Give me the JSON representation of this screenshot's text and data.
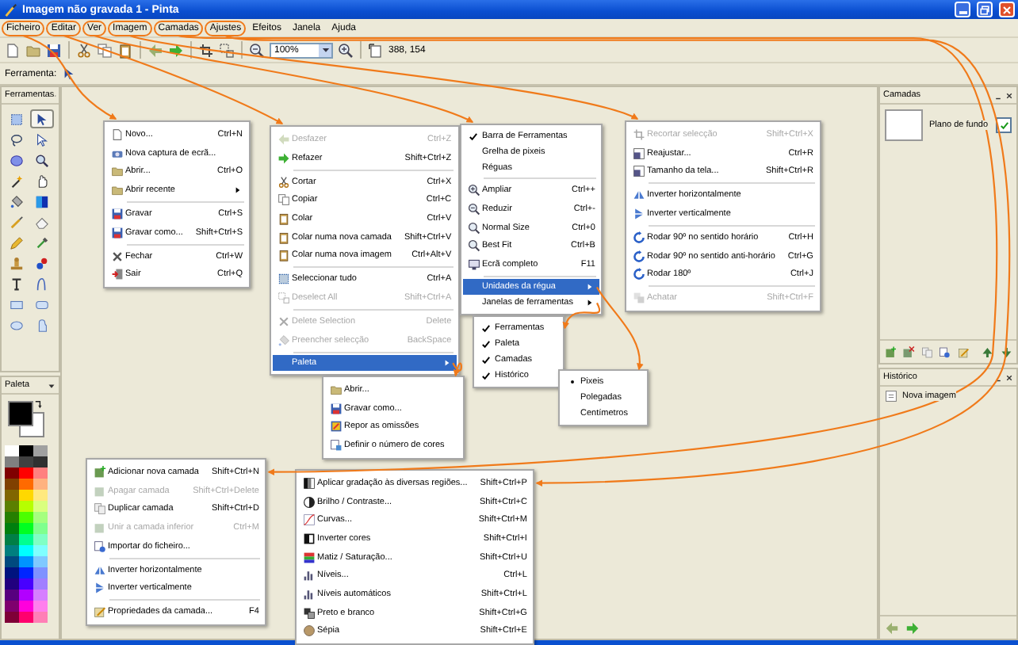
{
  "window": {
    "title": "Imagem não gravada 1 - Pinta"
  },
  "menubar": [
    {
      "label": "Ficheiro",
      "circled": true
    },
    {
      "label": "Editar",
      "circled": true
    },
    {
      "label": "Ver",
      "circled": true
    },
    {
      "label": "Imagem",
      "circled": true
    },
    {
      "label": "Camadas",
      "circled": true
    },
    {
      "label": "Ajustes",
      "circled": true
    },
    {
      "label": "Efeitos",
      "circled": false
    },
    {
      "label": "Janela",
      "circled": false
    },
    {
      "label": "Ajuda",
      "circled": false
    }
  ],
  "toolbar": {
    "zoom": "100%",
    "cursor_position": "388, 154"
  },
  "tool_options": {
    "label": "Ferramenta:"
  },
  "tools_panel": {
    "title": "Ferramentas",
    "tools": [
      {
        "kind": "rectangle-select",
        "selected": false
      },
      {
        "kind": "move-selected",
        "selected": true
      },
      {
        "kind": "lasso",
        "selected": false
      },
      {
        "kind": "move-selection",
        "selected": false
      },
      {
        "kind": "ellipse-select",
        "selected": false
      },
      {
        "kind": "zoom",
        "selected": false
      },
      {
        "kind": "magic-wand",
        "selected": false
      },
      {
        "kind": "pan",
        "selected": false
      },
      {
        "kind": "paint-bucket",
        "selected": false
      },
      {
        "kind": "gradient",
        "selected": false
      },
      {
        "kind": "paintbrush",
        "selected": false
      },
      {
        "kind": "eraser",
        "selected": false
      },
      {
        "kind": "pencil",
        "selected": false
      },
      {
        "kind": "color-picker",
        "selected": false
      },
      {
        "kind": "clone-stamp",
        "selected": false
      },
      {
        "kind": "recolor",
        "selected": false
      },
      {
        "kind": "text",
        "selected": false
      },
      {
        "kind": "line",
        "selected": false
      },
      {
        "kind": "rectangle",
        "selected": false
      },
      {
        "kind": "rounded-rectangle",
        "selected": false
      },
      {
        "kind": "ellipse",
        "selected": false
      },
      {
        "kind": "freeform",
        "selected": false
      }
    ]
  },
  "palette_panel": {
    "title": "Paleta",
    "current_colors": [
      {
        "color": "#000000"
      },
      {
        "color": "#ffffff"
      }
    ],
    "colors": [
      {
        "color": "#ffffff"
      },
      {
        "color": "#000000"
      },
      {
        "color": "#a0a0a0"
      },
      {
        "color": "#808080"
      },
      {
        "color": "#404040"
      },
      {
        "color": "#303030"
      },
      {
        "color": "#800000"
      },
      {
        "color": "#ff0000"
      },
      {
        "color": "#ff8080"
      },
      {
        "color": "#804000"
      },
      {
        "color": "#ff6a00"
      },
      {
        "color": "#ffb280"
      },
      {
        "color": "#806600"
      },
      {
        "color": "#ffd800"
      },
      {
        "color": "#ffe97f"
      },
      {
        "color": "#5b7f00"
      },
      {
        "color": "#b6ff00"
      },
      {
        "color": "#daff7f"
      },
      {
        "color": "#267f00"
      },
      {
        "color": "#4cff00"
      },
      {
        "color": "#a5ff7f"
      },
      {
        "color": "#007f0e"
      },
      {
        "color": "#00ff21"
      },
      {
        "color": "#7fff8e"
      },
      {
        "color": "#007f46"
      },
      {
        "color": "#00ff90"
      },
      {
        "color": "#7fffc5"
      },
      {
        "color": "#007f7f"
      },
      {
        "color": "#00ffff"
      },
      {
        "color": "#7fffff"
      },
      {
        "color": "#004a7f"
      },
      {
        "color": "#0094ff"
      },
      {
        "color": "#7fc9ff"
      },
      {
        "color": "#00137f"
      },
      {
        "color": "#0026ff"
      },
      {
        "color": "#7f92ff"
      },
      {
        "color": "#21007f"
      },
      {
        "color": "#4800ff"
      },
      {
        "color": "#a17fff"
      },
      {
        "color": "#57007f"
      },
      {
        "color": "#b200ff"
      },
      {
        "color": "#d67fff"
      },
      {
        "color": "#7f006e"
      },
      {
        "color": "#ff00dc"
      },
      {
        "color": "#ff7fed"
      },
      {
        "color": "#7f0037"
      },
      {
        "color": "#ff006e"
      },
      {
        "color": "#ff7fb6"
      }
    ]
  },
  "layers_panel": {
    "title": "Camadas",
    "layers": [
      {
        "name": "Plano de fundo",
        "visible": true
      }
    ]
  },
  "history_panel": {
    "title": "Histórico",
    "items": [
      {
        "label": "Nova imagem",
        "selected": false
      }
    ]
  },
  "menus": [
    {
      "items": [
        {
          "kind": "item",
          "label": "Novo...",
          "shortcut": "Ctrl+N",
          "disabled": false,
          "highlighted": false
        },
        {
          "kind": "item",
          "label": "Nova captura de ecrã...",
          "disabled": false,
          "highlighted": false
        },
        {
          "kind": "item",
          "label": "Abrir...",
          "shortcut": "Ctrl+O",
          "disabled": false,
          "highlighted": false
        },
        {
          "kind": "submenu",
          "label": "Abrir recente",
          "disabled": false,
          "highlighted": false
        },
        {
          "kind": "separator"
        },
        {
          "kind": "item",
          "label": "Gravar",
          "shortcut": "Ctrl+S",
          "disabled": false,
          "highlighted": false
        },
        {
          "kind": "item",
          "label": "Gravar como...",
          "shortcut": "Shift+Ctrl+S",
          "disabled": false,
          "highlighted": false
        },
        {
          "kind": "separator"
        },
        {
          "kind": "item",
          "label": "Fechar",
          "shortcut": "Ctrl+W",
          "disabled": false,
          "highlighted": false
        },
        {
          "kind": "item",
          "label": "Sair",
          "shortcut": "Ctrl+Q",
          "disabled": false,
          "highlighted": false
        }
      ]
    },
    {
      "items": [
        {
          "kind": "item",
          "label": "Desfazer",
          "shortcut": "Ctrl+Z",
          "disabled": true,
          "highlighted": false
        },
        {
          "kind": "item",
          "label": "Refazer",
          "shortcut": "Shift+Ctrl+Z",
          "disabled": false,
          "highlighted": false
        },
        {
          "kind": "separator"
        },
        {
          "kind": "item",
          "label": "Cortar",
          "shortcut": "Ctrl+X",
          "disabled": false,
          "highlighted": false
        },
        {
          "kind": "item",
          "label": "Copiar",
          "shortcut": "Ctrl+C",
          "disabled": false,
          "highlighted": false
        },
        {
          "kind": "item",
          "label": "Colar",
          "shortcut": "Ctrl+V",
          "disabled": false,
          "highlighted": false
        },
        {
          "kind": "item",
          "label": "Colar numa nova camada",
          "shortcut": "Shift+Ctrl+V",
          "disabled": false,
          "highlighted": false
        },
        {
          "kind": "item",
          "label": "Colar numa nova imagem",
          "shortcut": "Ctrl+Alt+V",
          "disabled": false,
          "highlighted": false
        },
        {
          "kind": "separator"
        },
        {
          "kind": "item",
          "label": "Seleccionar tudo",
          "shortcut": "Ctrl+A",
          "disabled": false,
          "highlighted": false
        },
        {
          "kind": "item",
          "label": "Deselect All",
          "shortcut": "Shift+Ctrl+A",
          "disabled": true,
          "highlighted": false
        },
        {
          "kind": "separator"
        },
        {
          "kind": "item",
          "label": "Delete Selection",
          "shortcut": "Delete",
          "disabled": true,
          "highlighted": false
        },
        {
          "kind": "item",
          "label": "Preencher selecção",
          "shortcut": "BackSpace",
          "disabled": true,
          "highlighted": false
        },
        {
          "kind": "separator"
        },
        {
          "kind": "submenu",
          "label": "Paleta",
          "disabled": false,
          "highlighted": true
        }
      ]
    },
    {
      "items": [
        {
          "kind": "check",
          "label": "Barra de Ferramentas",
          "checked": true,
          "disabled": false,
          "highlighted": false
        },
        {
          "kind": "check",
          "label": "Grelha de pixeis",
          "checked": false,
          "disabled": false,
          "highlighted": false
        },
        {
          "kind": "check",
          "label": "Réguas",
          "checked": false,
          "disabled": false,
          "highlighted": false
        },
        {
          "kind": "separator"
        },
        {
          "kind": "item",
          "label": "Ampliar",
          "shortcut": "Ctrl++",
          "disabled": false,
          "highlighted": false
        },
        {
          "kind": "item",
          "label": "Reduzir",
          "shortcut": "Ctrl+-",
          "disabled": false,
          "highlighted": false
        },
        {
          "kind": "item",
          "label": "Normal Size",
          "shortcut": "Ctrl+0",
          "disabled": false,
          "highlighted": false
        },
        {
          "kind": "item",
          "label": "Best Fit",
          "shortcut": "Ctrl+B",
          "disabled": false,
          "highlighted": false
        },
        {
          "kind": "item",
          "label": "Ecrã completo",
          "shortcut": "F11",
          "disabled": false,
          "highlighted": false
        },
        {
          "kind": "separator"
        },
        {
          "kind": "submenu",
          "label": "Unidades da régua",
          "disabled": false,
          "highlighted": true
        },
        {
          "kind": "submenu",
          "label": "Janelas de ferramentas",
          "disabled": false,
          "highlighted": false
        }
      ]
    },
    {
      "items": [
        {
          "kind": "item",
          "label": "Recortar selecção",
          "shortcut": "Shift+Ctrl+X",
          "disabled": true,
          "highlighted": false
        },
        {
          "kind": "item",
          "label": "Reajustar...",
          "shortcut": "Ctrl+R",
          "disabled": false,
          "highlighted": false
        },
        {
          "kind": "item",
          "label": "Tamanho da tela...",
          "shortcut": "Shift+Ctrl+R",
          "disabled": false,
          "highlighted": false
        },
        {
          "kind": "separator"
        },
        {
          "kind": "item",
          "label": "Inverter horizontalmente",
          "disabled": false,
          "highlighted": false
        },
        {
          "kind": "item",
          "label": "Inverter verticalmente",
          "disabled": false,
          "highlighted": false
        },
        {
          "kind": "separator"
        },
        {
          "kind": "item",
          "label": "Rodar 90º no sentido horário",
          "shortcut": "Ctrl+H",
          "disabled": false,
          "highlighted": false
        },
        {
          "kind": "item",
          "label": "Rodar 90º no sentido anti-horário",
          "shortcut": "Ctrl+G",
          "disabled": false,
          "highlighted": false
        },
        {
          "kind": "item",
          "label": "Rodar 180º",
          "shortcut": "Ctrl+J",
          "disabled": false,
          "highlighted": false
        },
        {
          "kind": "separator"
        },
        {
          "kind": "item",
          "label": "Achatar",
          "shortcut": "Shift+Ctrl+F",
          "disabled": true,
          "highlighted": false
        }
      ]
    },
    {
      "items": [
        {
          "kind": "check",
          "label": "Ferramentas",
          "checked": true,
          "disabled": false,
          "highlighted": false
        },
        {
          "kind": "check",
          "label": "Paleta",
          "checked": true,
          "disabled": false,
          "highlighted": false
        },
        {
          "kind": "check",
          "label": "Camadas",
          "checked": true,
          "disabled": false,
          "highlighted": false
        },
        {
          "kind": "check",
          "label": "Histórico",
          "checked": true,
          "disabled": false,
          "highlighted": false
        }
      ]
    },
    {
      "items": [
        {
          "kind": "radio",
          "label": "Pixeis",
          "selected": true,
          "disabled": false,
          "highlighted": false
        },
        {
          "kind": "radio",
          "label": "Polegadas",
          "selected": false,
          "disabled": false,
          "highlighted": false
        },
        {
          "kind": "radio",
          "label": "Centímetros",
          "selected": false,
          "disabled": false,
          "highlighted": false
        }
      ]
    },
    {
      "items": [
        {
          "kind": "item",
          "label": "Abrir...",
          "disabled": false,
          "highlighted": false
        },
        {
          "kind": "item",
          "label": "Gravar como...",
          "disabled": false,
          "highlighted": false
        },
        {
          "kind": "item",
          "label": "Repor as omissões",
          "disabled": false,
          "highlighted": false
        },
        {
          "kind": "item",
          "label": "Definir o número de cores",
          "disabled": false,
          "highlighted": false
        }
      ]
    },
    {
      "items": [
        {
          "kind": "item",
          "label": "Adicionar nova camada",
          "shortcut": "Shift+Ctrl+N",
          "disabled": false,
          "highlighted": false
        },
        {
          "kind": "item",
          "label": "Apagar camada",
          "shortcut": "Shift+Ctrl+Delete",
          "disabled": true,
          "highlighted": false
        },
        {
          "kind": "item",
          "label": "Duplicar camada",
          "shortcut": "Shift+Ctrl+D",
          "disabled": false,
          "highlighted": false
        },
        {
          "kind": "item",
          "label": "Unir a camada inferior",
          "shortcut": "Ctrl+M",
          "disabled": true,
          "highlighted": false
        },
        {
          "kind": "item",
          "label": "Importar do ficheiro...",
          "disabled": false,
          "highlighted": false
        },
        {
          "kind": "separator"
        },
        {
          "kind": "item",
          "label": "Inverter horizontalmente",
          "disabled": false,
          "highlighted": false
        },
        {
          "kind": "item",
          "label": "Inverter verticalmente",
          "disabled": false,
          "highlighted": false
        },
        {
          "kind": "separator"
        },
        {
          "kind": "item",
          "label": "Propriedades da camada...",
          "shortcut": "F4",
          "disabled": false,
          "highlighted": false
        }
      ]
    },
    {
      "items": [
        {
          "kind": "item",
          "label": "Aplicar gradação às diversas regiões...",
          "shortcut": "Shift+Ctrl+P",
          "disabled": false,
          "highlighted": false
        },
        {
          "kind": "item",
          "label": "Brilho / Contraste...",
          "shortcut": "Shift+Ctrl+C",
          "disabled": false,
          "highlighted": false
        },
        {
          "kind": "item",
          "label": "Curvas...",
          "shortcut": "Shift+Ctrl+M",
          "disabled": false,
          "highlighted": false
        },
        {
          "kind": "item",
          "label": "Inverter cores",
          "shortcut": "Shift+Ctrl+I",
          "disabled": false,
          "highlighted": false
        },
        {
          "kind": "item",
          "label": "Matiz / Saturação...",
          "shortcut": "Shift+Ctrl+U",
          "disabled": false,
          "highlighted": false
        },
        {
          "kind": "item",
          "label": "Níveis...",
          "shortcut": "Ctrl+L",
          "disabled": false,
          "highlighted": false
        },
        {
          "kind": "item",
          "label": "Níveis automáticos",
          "shortcut": "Shift+Ctrl+L",
          "disabled": false,
          "highlighted": false
        },
        {
          "kind": "item",
          "label": "Preto e branco",
          "shortcut": "Shift+Ctrl+G",
          "disabled": false,
          "highlighted": false
        },
        {
          "kind": "item",
          "label": "Sépia",
          "shortcut": "Shift+Ctrl+E",
          "disabled": false,
          "highlighted": false
        }
      ]
    }
  ]
}
